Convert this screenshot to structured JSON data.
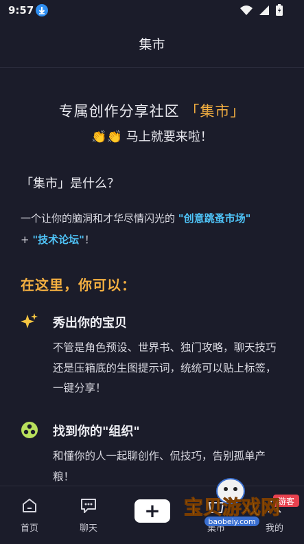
{
  "status": {
    "time": "9:57"
  },
  "header": {
    "title": "集市"
  },
  "hero": {
    "line1_prefix": "专属创作分享社区 ",
    "line1_accent": "「集市」",
    "line2_emoji": "👏👏",
    "line2_text": " 马上就要来啦！"
  },
  "question": "「集市」是什么？",
  "description": {
    "prefix": "一个让你的脑洞和才华尽情闪光的",
    "link1": "\"创意跳蚤市场\"",
    "middle": "+ ",
    "link2": "\"技术论坛\"",
    "suffix": "！"
  },
  "section_title": "在这里，你可以：",
  "features": [
    {
      "icon": "sparkle-icon",
      "title": "秀出你的宝贝",
      "desc": "不管是角色预设、世界书、独门攻略，聊天技巧还是压箱底的生图提示词，统统可以贴上标签，一键分享！"
    },
    {
      "icon": "group-icon",
      "title": "找到你的\"组织\"",
      "desc": "和懂你的人一起聊创作、侃技巧，告别孤单产粮！"
    }
  ],
  "nav": {
    "items": [
      {
        "label": "首页",
        "icon": "home-icon"
      },
      {
        "label": "聊天",
        "icon": "chat-icon"
      },
      {
        "label": "集市",
        "icon": "market-icon"
      },
      {
        "label": "我的",
        "icon": "profile-icon"
      }
    ],
    "plus": "+"
  },
  "watermark": {
    "text": "宝贝游戏网",
    "badge": "游客",
    "url": "baobeiy.com"
  },
  "colors": {
    "background": "#1b1c2a",
    "accent": "#f5b041",
    "link": "#4fc3f7"
  }
}
